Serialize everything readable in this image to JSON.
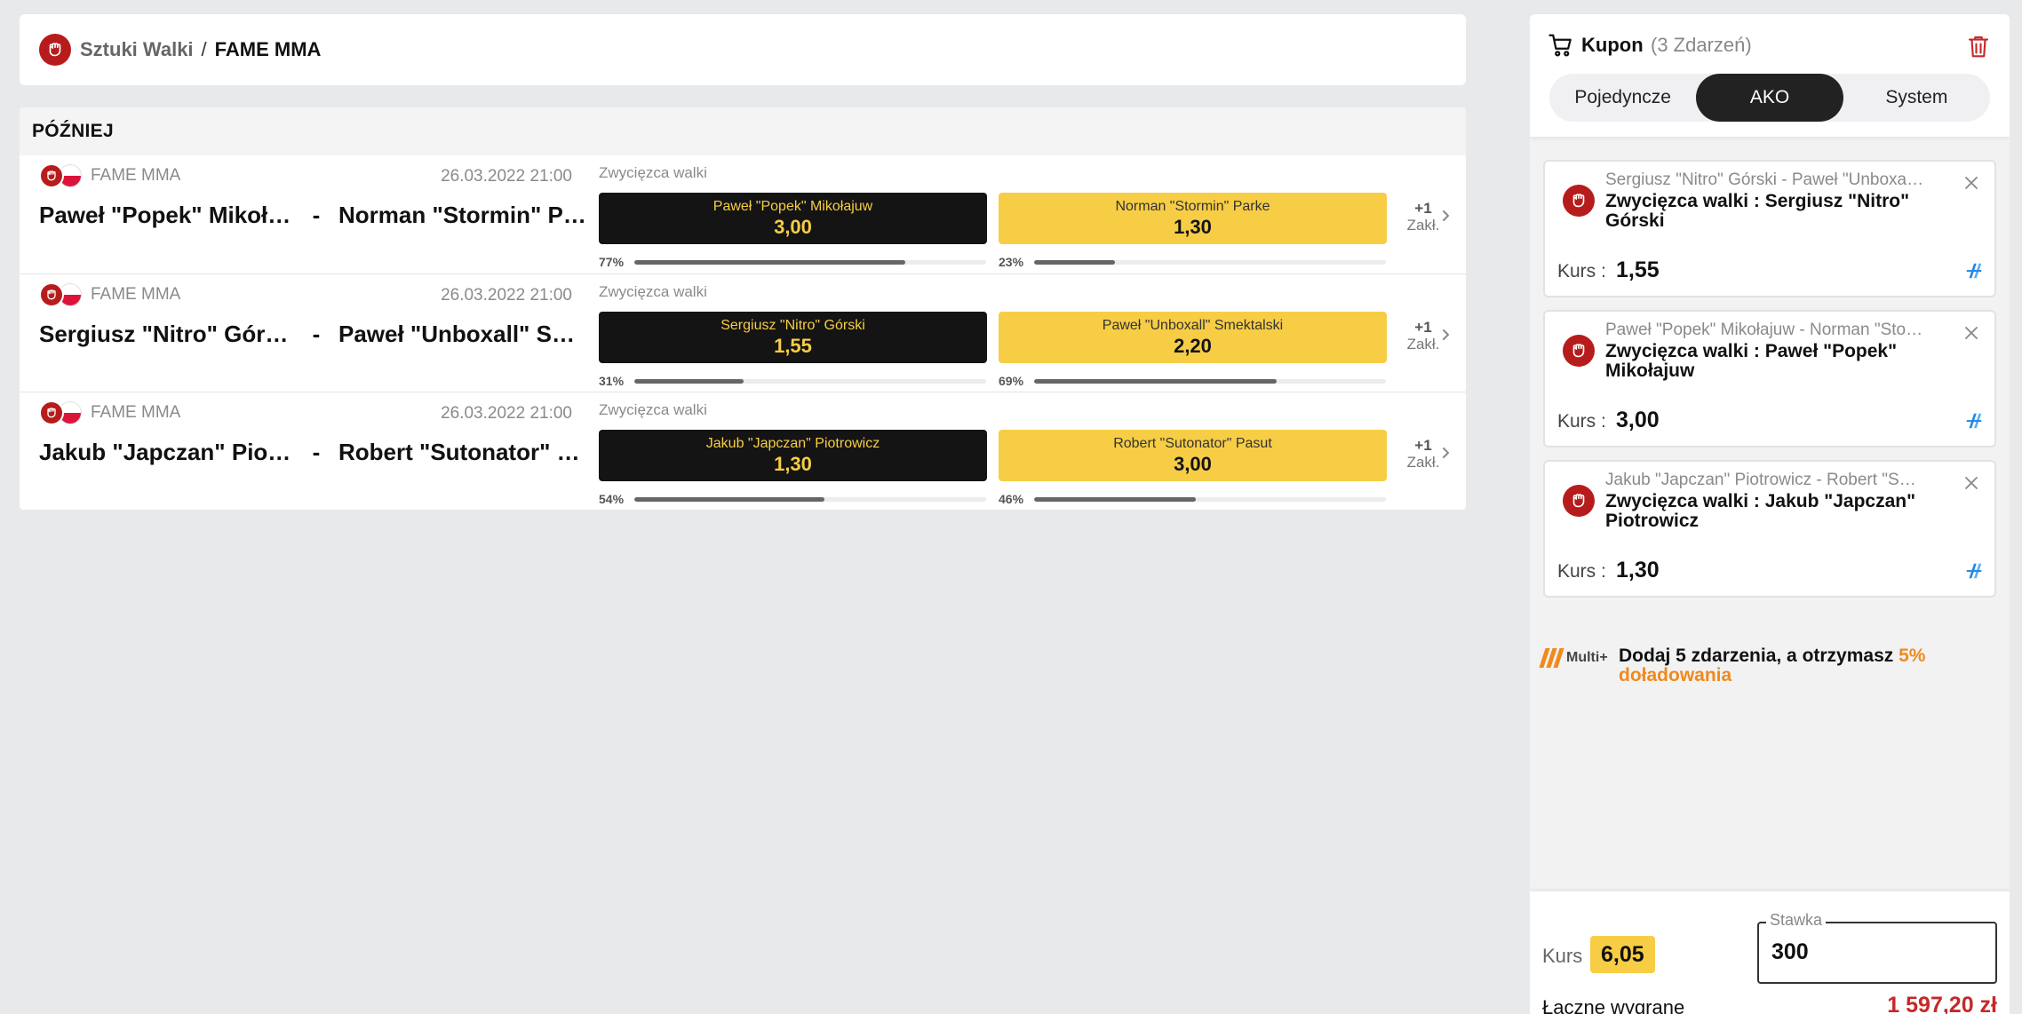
{
  "breadcrumb": {
    "parent": "Sztuki Walki",
    "separator": "/",
    "current": "FAME MMA"
  },
  "section": {
    "title": "PÓŹNIEJ"
  },
  "events": [
    {
      "league": "FAME MMA",
      "date": "26.03.2022 21:00",
      "home": "Paweł \"Popek\" Mikołajuw",
      "away": "Norman \"Stormin\" Parke",
      "dash": "-",
      "market": "Zwycięzca walki",
      "home_odd": "3,00",
      "away_odd": "1,30",
      "home_pct": "77%",
      "away_pct": "23%",
      "home_fill": 0.77,
      "away_fill": 0.23,
      "more_count": "+1",
      "more_label": "Zakł."
    },
    {
      "league": "FAME MMA",
      "date": "26.03.2022 21:00",
      "home": "Sergiusz \"Nitro\" Górski",
      "away": "Paweł \"Unboxall\" Smektalski",
      "dash": "-",
      "market": "Zwycięzca walki",
      "home_odd": "1,55",
      "away_odd": "2,20",
      "home_pct": "31%",
      "away_pct": "69%",
      "home_fill": 0.31,
      "away_fill": 0.69,
      "more_count": "+1",
      "more_label": "Zakł."
    },
    {
      "league": "FAME MMA",
      "date": "26.03.2022 21:00",
      "home": "Jakub \"Japczan\" Piotrowicz",
      "away": "Robert \"Sutonator\" Pasut",
      "dash": "-",
      "market": "Zwycięzca walki",
      "home_odd": "1,30",
      "away_odd": "3,00",
      "home_pct": "54%",
      "away_pct": "46%",
      "home_fill": 0.54,
      "away_fill": 0.46,
      "more_count": "+1",
      "more_label": "Zakł."
    }
  ],
  "coupon": {
    "title": "Kupon",
    "count": "(3 Zdarzeń)",
    "tabs": [
      {
        "label": "Pojedyncze",
        "active": false
      },
      {
        "label": "AKO",
        "active": true
      },
      {
        "label": "System",
        "active": false
      }
    ],
    "selections": [
      {
        "event": "Sergiusz \"Nitro\" Górski - Paweł \"Unboxall\" Smektalski",
        "pick": "Zwycięzca walki : Sergiusz \"Nitro\" Górski",
        "kurs_label": "Kurs :",
        "kurs": "1,55"
      },
      {
        "event": "Paweł \"Popek\" Mikołajuw - Norman \"Stormin\" Parke",
        "pick": "Zwycięzca walki : Paweł \"Popek\" Mikołajuw",
        "kurs_label": "Kurs :",
        "kurs": "3,00"
      },
      {
        "event": "Jakub \"Japczan\" Piotrowicz - Robert \"Sutonator\" Pasut",
        "pick": "Zwycięzca walki : Jakub \"Japczan\" Piotrowicz",
        "kurs_label": "Kurs :",
        "kurs": "1,30"
      }
    ],
    "promo": {
      "logo": "Multi+",
      "text": "Dodaj 5 zdarzenia, a otrzymasz ",
      "highlight": "5% doładowania"
    },
    "footer": {
      "kurs_label": "Kurs",
      "kurs": "6,05",
      "stake_label": "Stawka",
      "stake": "300",
      "win_label": "Łączne wygrane",
      "win": "1 597,20 zł"
    }
  },
  "colors": {
    "accent_yellow": "#f7cd45",
    "dark_button": "#141414",
    "brand_red": "#b71c1c",
    "promo_orange": "#f08a1c",
    "win_red": "#c62828",
    "boost_blue": "#1e88e5"
  },
  "icons": [
    "fist-icon",
    "flag-poland-icon",
    "chevron-right-icon",
    "cart-icon",
    "trash-icon",
    "close-icon",
    "boost-icon",
    "multi-plus-logo"
  ]
}
